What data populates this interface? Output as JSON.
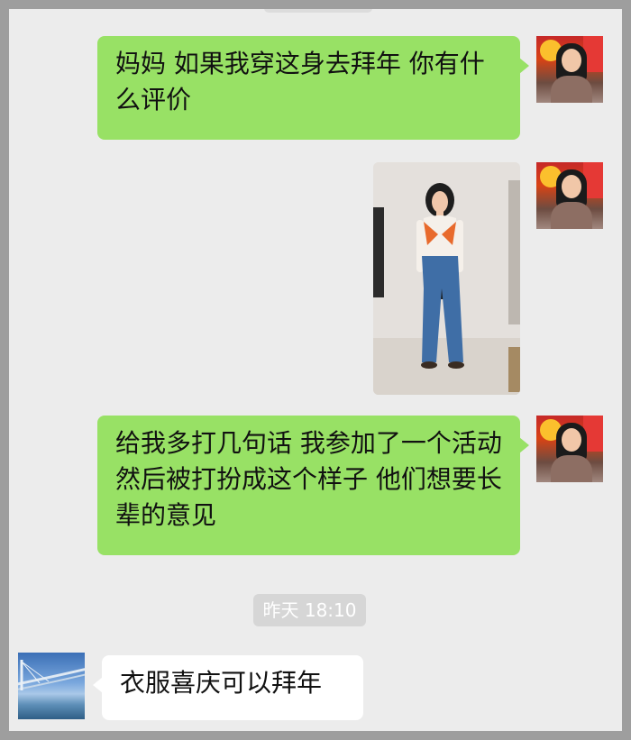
{
  "messages": [
    {
      "sender": "me",
      "type": "text",
      "text": "妈妈 如果我穿这身去拜年 你有什么评价"
    },
    {
      "sender": "me",
      "type": "image"
    },
    {
      "sender": "me",
      "type": "text",
      "text": "给我多打几句话 我参加了一个活动 然后被打扮成这个样子 他们想要长辈的意见"
    },
    {
      "sender": "other",
      "type": "text",
      "text": "衣服喜庆可以拜年"
    }
  ],
  "timestamp": "昨天 18:10",
  "colors": {
    "background": "#ececec",
    "my_bubble": "#98e165",
    "their_bubble": "#ffffff",
    "timestamp_bg": "#d6d6d6"
  }
}
